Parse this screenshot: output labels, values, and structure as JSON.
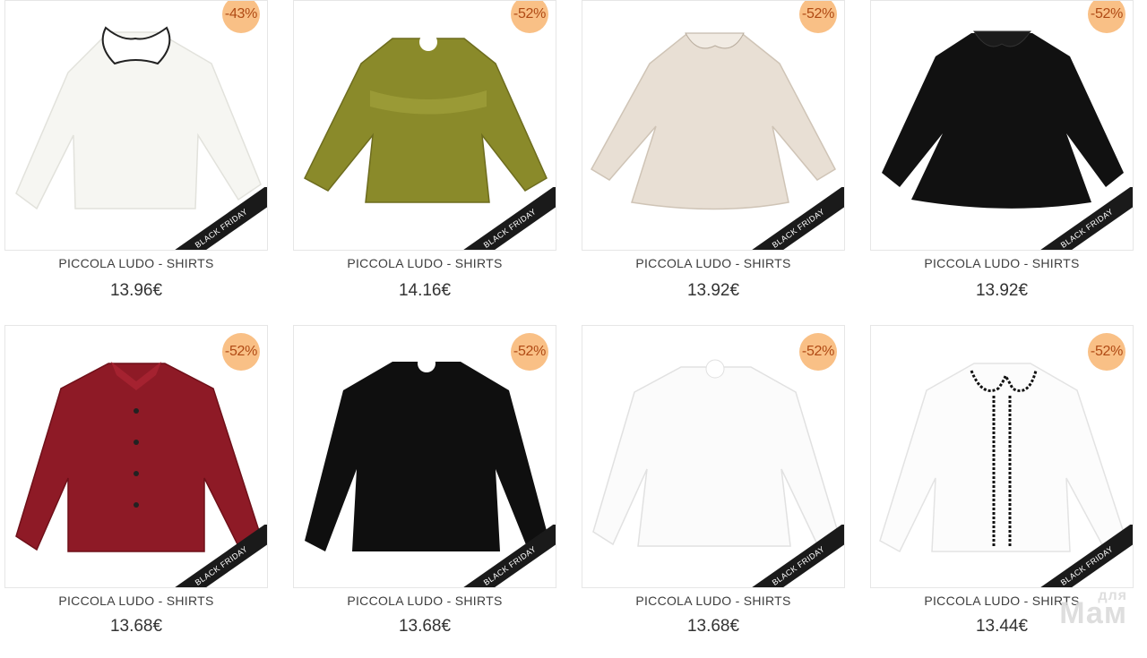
{
  "products": [
    {
      "title": "PICCOLA LUDO - SHIRTS",
      "price": "13.96€",
      "discount": "-43%",
      "ribbon": "BLACK FRIDAY",
      "image": "white-blouse-ruffle-collar"
    },
    {
      "title": "PICCOLA LUDO - SHIRTS",
      "price": "14.16€",
      "discount": "-52%",
      "ribbon": "BLACK FRIDAY",
      "image": "olive-ruffled-blouse"
    },
    {
      "title": "PICCOLA LUDO - SHIRTS",
      "price": "13.92€",
      "discount": "-52%",
      "ribbon": "BLACK FRIDAY",
      "image": "beige-peter-pan-blouse"
    },
    {
      "title": "PICCOLA LUDO - SHIRTS",
      "price": "13.92€",
      "discount": "-52%",
      "ribbon": "BLACK FRIDAY",
      "image": "black-peter-pan-blouse"
    },
    {
      "title": "PICCOLA LUDO - SHIRTS",
      "price": "13.68€",
      "discount": "-52%",
      "ribbon": "BLACK FRIDAY",
      "image": "red-button-shirt"
    },
    {
      "title": "PICCOLA LUDO - SHIRTS",
      "price": "13.68€",
      "discount": "-52%",
      "ribbon": "BLACK FRIDAY",
      "image": "black-puff-sleeve-blouse"
    },
    {
      "title": "PICCOLA LUDO - SHIRTS",
      "price": "13.68€",
      "discount": "-52%",
      "ribbon": "BLACK FRIDAY",
      "image": "white-puff-sleeve-blouse"
    },
    {
      "title": "PICCOLA LUDO - SHIRTS",
      "price": "13.44€",
      "discount": "-52%",
      "ribbon": "BLACK FRIDAY",
      "image": "white-blouse-black-trim"
    }
  ],
  "watermark": {
    "line1": "для",
    "line2": "Мам"
  },
  "colors": {
    "badge": "#f9c086",
    "badge_text": "#b04a14",
    "ribbon": "#1a1a1a"
  }
}
